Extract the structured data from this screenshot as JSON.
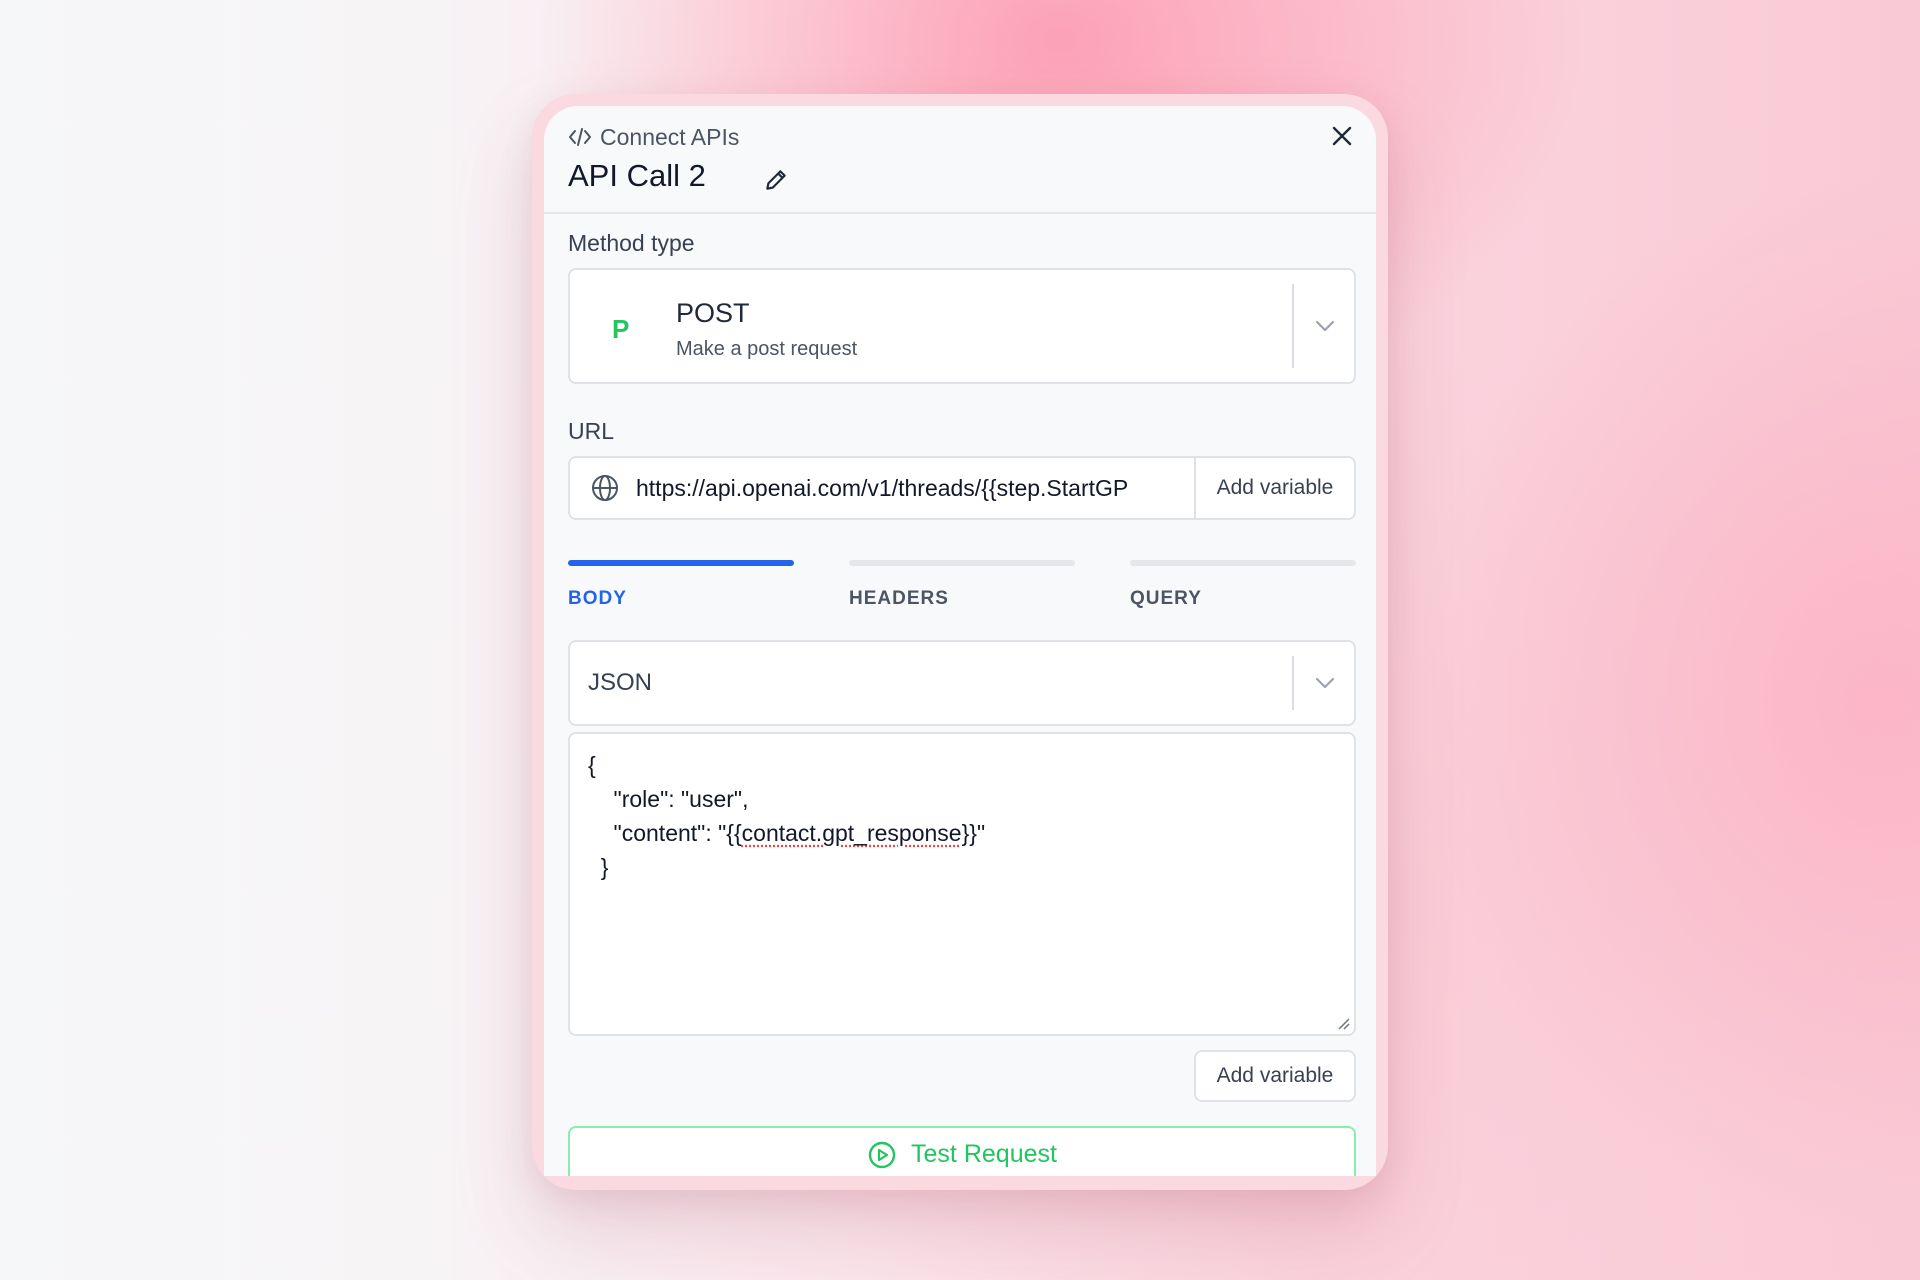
{
  "header": {
    "breadcrumb": "Connect APIs",
    "title": "API Call 2"
  },
  "method": {
    "label": "Method type",
    "letter": "P",
    "name": "POST",
    "description": "Make a post request"
  },
  "url": {
    "label": "URL",
    "value": "https://api.openai.com/v1/threads/{{step.StartGP",
    "add_variable": "Add variable"
  },
  "tabs": [
    {
      "label": "BODY",
      "active": true
    },
    {
      "label": "HEADERS",
      "active": false
    },
    {
      "label": "QUERY",
      "active": false
    }
  ],
  "body": {
    "format": "JSON",
    "lines": [
      "{",
      "    \"role\": \"user\",",
      "    \"content\": \"{{",
      "contact.gpt_response",
      "}}\"",
      "  }"
    ],
    "add_variable": "Add variable"
  },
  "test_button": "Test Request",
  "colors": {
    "accent": "#2563eb",
    "success": "#22c55e"
  },
  "icons": [
    "code-icon",
    "close-icon",
    "pencil-icon",
    "chevron-down-icon",
    "globe-icon",
    "play-circle-icon",
    "resize-handle-icon"
  ]
}
